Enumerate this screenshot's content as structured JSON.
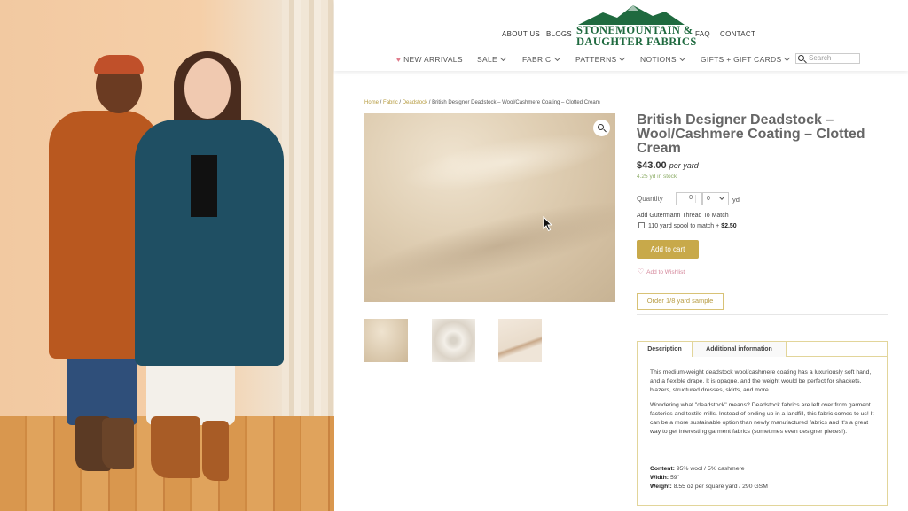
{
  "nav": {
    "top": [
      "ABOUT US",
      "BLOGS",
      "FAQ",
      "CONTACT"
    ],
    "main": [
      "NEW ARRIVALS",
      "SALE",
      "FABRIC",
      "PATTERNS",
      "NOTIONS",
      "GIFTS + GIFT CARDS"
    ],
    "search_placeholder": "Search"
  },
  "logo": {
    "line1": "STONEMOUNTAIN &",
    "line2": "DAUGHTER FABRICS"
  },
  "breadcrumb": {
    "home": "Home",
    "fabric": "Fabric",
    "deadstock": "Deadstock",
    "sep": " / ",
    "current": "British Designer Deadstock – Wool/Cashmere Coating – Clotted Cream"
  },
  "product": {
    "title": "British Designer Deadstock – Wool/Cashmere Coating – Clotted Cream",
    "price": "$43.00",
    "price_unit": "per yard",
    "stock": "4.25 yd in stock",
    "quantity_label": "Quantity",
    "quantity_value": "0",
    "quantity_fraction": "0",
    "quantity_unit": "yd",
    "thread_heading": "Add Gutermann Thread To Match",
    "spool_label": "110 yard spool to match +",
    "spool_price": "$2.50",
    "add_to_cart": "Add to cart",
    "wishlist": "Add to Wishlist",
    "sample": "Order 1/8 yard sample"
  },
  "tabs": {
    "description": "Description",
    "additional": "Additional information"
  },
  "description": {
    "p1": "This medium-weight deadstock wool/cashmere coating has a luxuriously soft hand, and a flexible drape. It is opaque, and the weight would be perfect for shackets, blazers, structured dresses, skirts, and more.",
    "p2": "Wondering what \"deadstock\" means? Deadstock fabrics are left over from garment factories and textile mills. Instead of ending up in a landfill, this fabric comes to us! It can be a more sustainable option than newly manufactured fabrics and it's a great way to get interesting garment fabrics (sometimes even designer pieces!).",
    "content_label": "Content:",
    "content_value": "95% wool / 5% cashmere",
    "width_label": "Width:",
    "width_value": "59\"",
    "weight_label": "Weight:",
    "weight_value": "8.55 oz per square yard / 290 GSM"
  },
  "colors": {
    "accent_gold": "#c8a94a",
    "logo_green": "#1f6a3f",
    "stock_green": "#8fae6a",
    "wishlist_pink": "#d4869a"
  }
}
